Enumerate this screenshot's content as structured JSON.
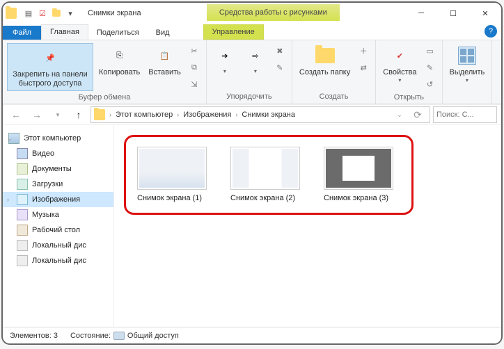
{
  "title": "Снимки экрана",
  "contextTab": "Средства работы с рисунками",
  "tabs": {
    "file": "Файл",
    "home": "Главная",
    "share": "Поделиться",
    "view": "Вид",
    "manage": "Управление"
  },
  "ribbon": {
    "pin": "Закрепить на панели быстрого доступа",
    "copy": "Копировать",
    "paste": "Вставить",
    "clipboard": "Буфер обмена",
    "organize": "Упорядочить",
    "newFolder": "Создать папку",
    "new": "Создать",
    "properties": "Свойства",
    "open": "Открыть",
    "select": "Выделить"
  },
  "breadcrumbs": [
    "Этот компьютер",
    "Изображения",
    "Снимки экрана"
  ],
  "search": {
    "placeholder": "Поиск: С..."
  },
  "nav": {
    "root": "Этот компьютер",
    "items": [
      {
        "label": "Видео",
        "cls": "ni-vid"
      },
      {
        "label": "Документы",
        "cls": "ni-doc"
      },
      {
        "label": "Загрузки",
        "cls": "ni-dl"
      },
      {
        "label": "Изображения",
        "cls": "ni-pic",
        "selected": true
      },
      {
        "label": "Музыка",
        "cls": "ni-mus"
      },
      {
        "label": "Рабочий стол",
        "cls": "ni-desk"
      },
      {
        "label": "Локальный дис",
        "cls": "ni-disk"
      },
      {
        "label": "Локальный дис",
        "cls": "ni-disk"
      }
    ]
  },
  "files": [
    {
      "label": "Снимок экрана (1)",
      "thumb": "t1"
    },
    {
      "label": "Снимок экрана (2)",
      "thumb": "t2"
    },
    {
      "label": "Снимок экрана (3)",
      "thumb": "t3"
    }
  ],
  "status": {
    "elements": "Элементов: 3",
    "state": "Состояние:",
    "shared": "Общий доступ"
  }
}
